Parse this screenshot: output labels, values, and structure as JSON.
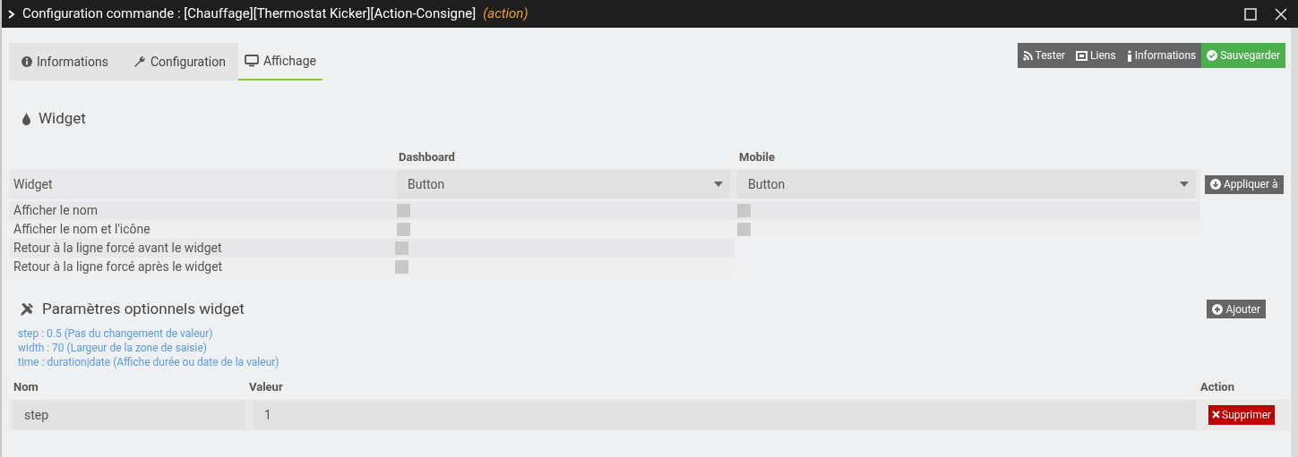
{
  "window": {
    "title": "Configuration commande : [Chauffage][Thermostat Kicker][Action-Consigne]",
    "type_label": "(action)"
  },
  "tabs": [
    {
      "label": "Informations",
      "selected": false
    },
    {
      "label": "Configuration",
      "selected": false
    },
    {
      "label": "Affichage",
      "selected": true
    }
  ],
  "toolbar": [
    {
      "label": "Tester",
      "kind": "default"
    },
    {
      "label": "Liens",
      "kind": "default"
    },
    {
      "label": "Informations",
      "kind": "default"
    },
    {
      "label": "Sauvegarder",
      "kind": "primary"
    }
  ],
  "widget_section": {
    "title": "Widget",
    "columns": [
      "Dashboard",
      "Mobile"
    ],
    "widget_row": {
      "label": "Widget",
      "dashboard": "Button",
      "mobile": "Button"
    },
    "apply_button": "Appliquer à",
    "options": [
      {
        "label": "Afficher le nom",
        "dashboard": {
          "checked": false
        },
        "mobile": {
          "checked": false
        }
      },
      {
        "label": "Afficher le nom et l'icône",
        "dashboard": {
          "checked": false
        },
        "mobile": {
          "checked": false
        }
      },
      {
        "label": "Retour à la ligne forcé avant le widget",
        "dashboard": {
          "checked": false
        }
      },
      {
        "label": "Retour à la ligne forcé après le widget",
        "dashboard": {
          "checked": false
        }
      }
    ]
  },
  "params_section": {
    "title": "Paramètres optionnels widget",
    "add_button": "Ajouter",
    "help": [
      "step : 0.5 (Pas du changement de valeur)",
      "width : 70 (Largeur de la zone de saisie)",
      "time : duration|date (Affiche durée ou date de la valeur)"
    ],
    "columns": [
      "Nom",
      "Valeur",
      "Action"
    ],
    "rows": [
      {
        "name": "step",
        "value": "1",
        "delete_button": "Supprimer"
      }
    ]
  }
}
